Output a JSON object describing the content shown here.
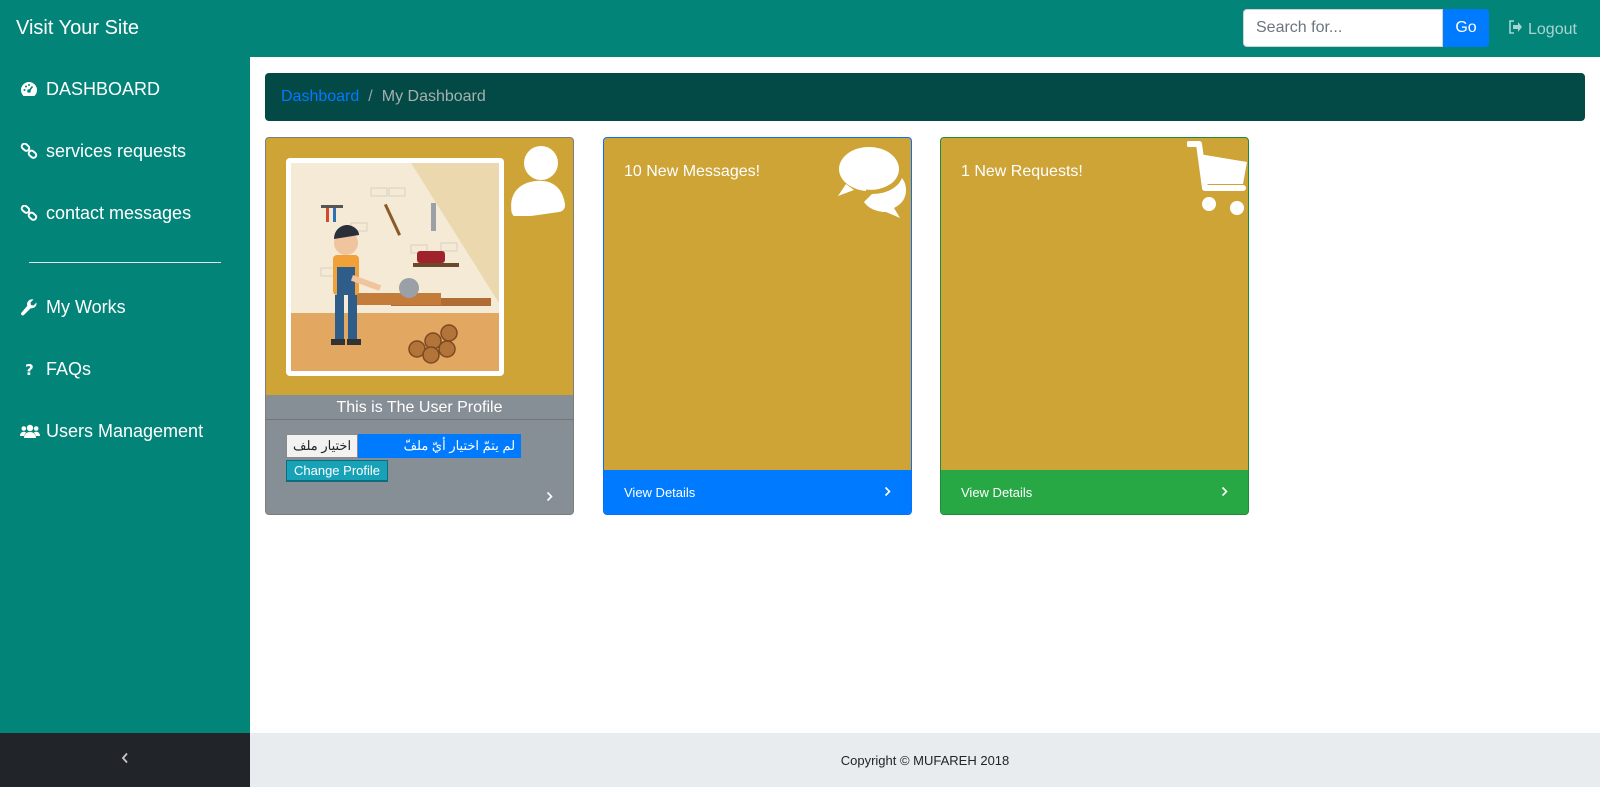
{
  "header": {
    "brand": "Visit Your Site",
    "search_placeholder": "Search for...",
    "go_label": "Go",
    "logout_label": "Logout"
  },
  "sidebar": {
    "items": [
      {
        "label": "DASHBOARD",
        "icon": "dashboard-icon"
      },
      {
        "label": "services requests",
        "icon": "link-icon"
      },
      {
        "label": "contact messages",
        "icon": "link-icon"
      },
      {
        "label": "My Works",
        "icon": "wrench-icon"
      },
      {
        "label": "FAQs",
        "icon": "question-icon"
      },
      {
        "label": "Users Management",
        "icon": "users-icon"
      }
    ],
    "toggle_icon": "chevron-left-icon"
  },
  "breadcrumb": {
    "link": "Dashboard",
    "separator": "/",
    "active": "My Dashboard"
  },
  "cards": {
    "profile": {
      "caption": "This is The User Profile",
      "file_button": "اختيار ملف",
      "file_status": "لم يتمّ اختيار أيّ ملفّ",
      "change_button": "Change Profile",
      "icon": "user-icon"
    },
    "messages": {
      "title": "10 New Messages!",
      "footer": "View Details",
      "icon": "comments-icon"
    },
    "requests": {
      "title": "1 New Requests!",
      "footer": "View Details",
      "icon": "shopping-cart-icon"
    }
  },
  "footer": {
    "copyright": "Copyright © MUFAREH 2018"
  },
  "colors": {
    "primary_teal": "#038479",
    "breadcrumb_bg": "#034a47",
    "card_gold": "#cfa437",
    "blue": "#007bff",
    "green": "#28a745",
    "gray": "#868e96"
  }
}
